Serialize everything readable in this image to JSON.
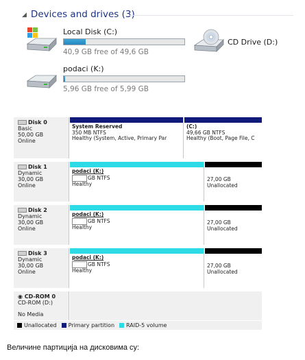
{
  "explorer": {
    "group_title": "Devices and drives (3)",
    "drives": [
      {
        "name": "Local Disk (C:)",
        "free_text": "40,9 GB free of 49,6 GB",
        "used_fraction": 0.18
      },
      {
        "name": "podaci (K:)",
        "free_text": "5,96 GB free of 5,99 GB",
        "used_fraction": 0.01
      },
      {
        "name": "CD Drive (D:)"
      }
    ]
  },
  "disk_management": {
    "disks": [
      {
        "name": "Disk 0",
        "type": "Basic",
        "size": "50,00 GB",
        "status": "Online",
        "partitions": [
          {
            "name": "System Reserved",
            "line1": "350 MB NTFS",
            "line2": "Healthy (System, Active, Primary Par"
          },
          {
            "name": "(C:)",
            "line1": "49,66 GB NTFS",
            "line2": "Healthy (Boot, Page File, C"
          }
        ]
      },
      {
        "name": "Disk 1",
        "type": "Dynamic",
        "size": "30,00 GB",
        "status": "Online",
        "partitions": [
          {
            "name": "podaci  (K:)",
            "line1": "GB NTFS",
            "line2": "Healthy"
          },
          {
            "name": "",
            "line1": "27,00 GB",
            "line2": "Unallocated"
          }
        ]
      },
      {
        "name": "Disk 2",
        "type": "Dynamic",
        "size": "30,00 GB",
        "status": "Online",
        "partitions": [
          {
            "name": "podaci  (K:)",
            "line1": "GB NTFS",
            "line2": "Healthy"
          },
          {
            "name": "",
            "line1": "27,00 GB",
            "line2": "Unallocated"
          }
        ]
      },
      {
        "name": "Disk 3",
        "type": "Dynamic",
        "size": "30,00 GB",
        "status": "Online",
        "partitions": [
          {
            "name": "podaci  (K:)",
            "line1": "GB NTFS",
            "line2": "Healthy"
          },
          {
            "name": "",
            "line1": "27,00 GB",
            "line2": "Unallocated"
          }
        ]
      },
      {
        "name": "CD-ROM 0",
        "type": "CD-ROM (D:)",
        "status": "No Media"
      }
    ],
    "legend": [
      "Unallocated",
      "Primary partition",
      "RAID-5 volume"
    ],
    "colors": {
      "unallocated": "#000000",
      "primary": "#101a7a",
      "raid5": "#2cdbe6"
    }
  },
  "caption": "Величине партиција на дисковима су:"
}
